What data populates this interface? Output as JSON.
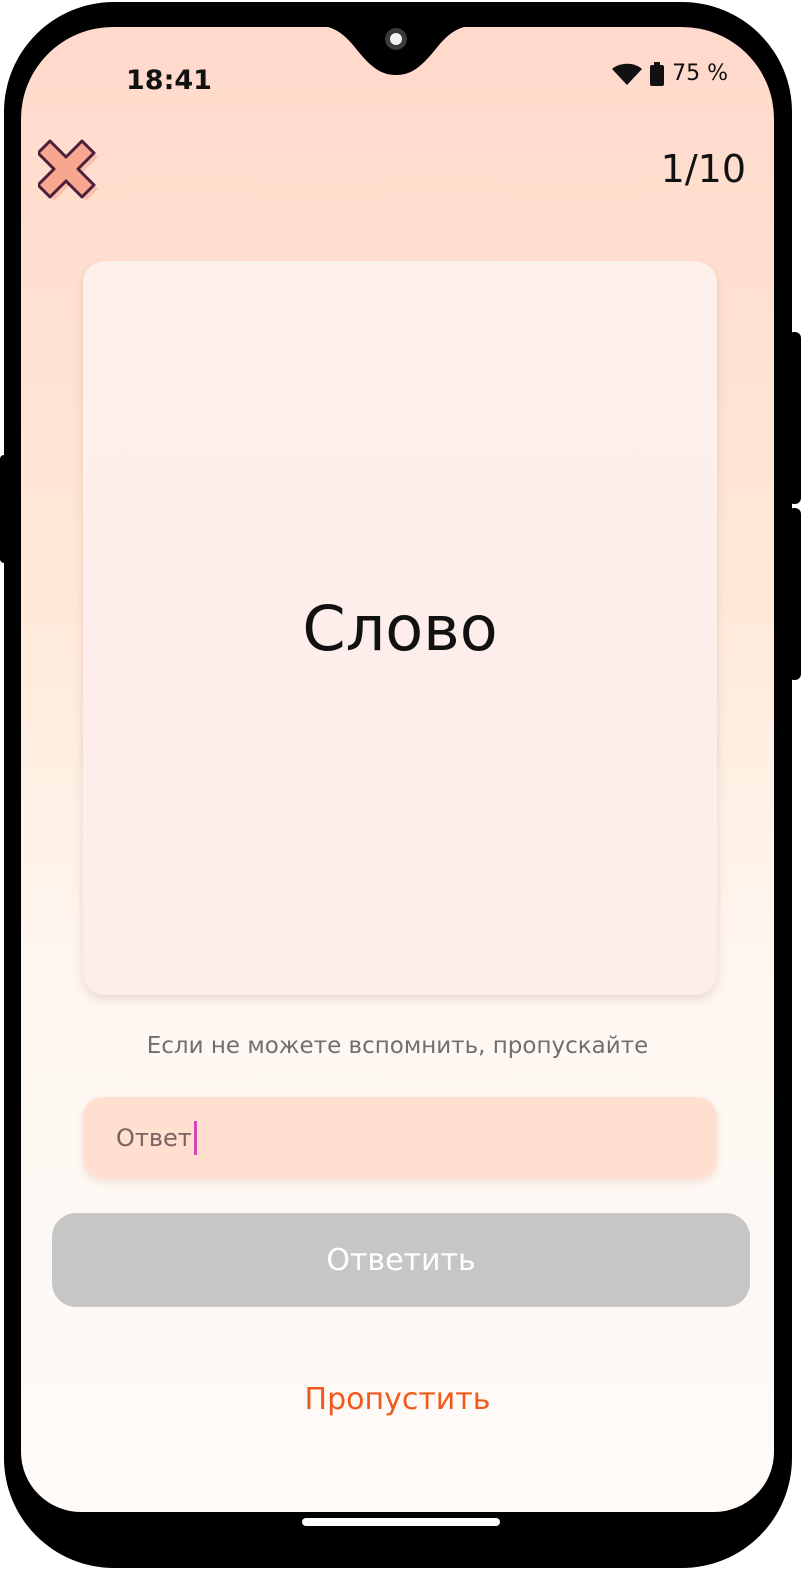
{
  "status_bar": {
    "time": "18:41",
    "battery": "75 %",
    "icons": [
      "wifi-icon",
      "battery-icon"
    ]
  },
  "header": {
    "close_icon": "close-icon",
    "progress": "1/10"
  },
  "card": {
    "word": "Слово"
  },
  "hint": "Если не можете вспомнить, пропускайте",
  "answer": {
    "placeholder": "Ответ",
    "value": ""
  },
  "buttons": {
    "submit_label": "Ответить",
    "skip_label": "Пропустить"
  },
  "colors": {
    "accent": "#f25a1c",
    "disabled_button": "#c6c6c6",
    "input_background": "#ffdfd0",
    "caret": "#d845b6"
  }
}
